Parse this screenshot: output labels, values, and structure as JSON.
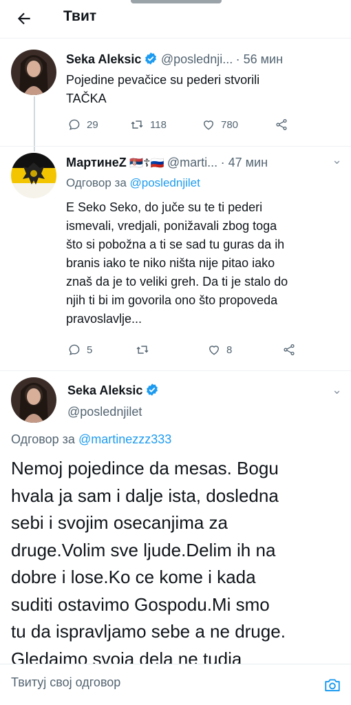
{
  "header": {
    "title": "Твит"
  },
  "tweet1": {
    "name": "Seka Aleksic",
    "handle": "@poslednji...",
    "time": "· 56 мин",
    "text_lines": [
      "Pojedine pevačice su pederi stvorili",
      "TAČKA"
    ],
    "replies": "29",
    "retweets": "118",
    "likes": "780"
  },
  "tweet2": {
    "name": "МартинеZ",
    "flags": "🇷🇸☦🇷🇺",
    "handle": "@marti...",
    "time": "· 47 мин",
    "replying_prefix": "Одговор за",
    "replying_to": "@poslednjilet",
    "text_lines": [
      "E Seko Seko, do juče su te ti pederi",
      "ismevali, vredjali, ponižavali zbog toga",
      "što si pobožna a ti se sad tu guras da ih",
      "branis iako te niko ništa nije pitao iako",
      "znaš da je to veliki greh. Da ti je stalo do",
      "njih ti bi im govorila ono što propoveda",
      "pravoslavlje..."
    ],
    "replies": "5",
    "retweets": "",
    "likes": "8"
  },
  "main_tweet": {
    "name": "Seka Aleksic",
    "handle": "@poslednjilet",
    "replying_prefix": "Одговор за",
    "replying_to": "@martinezzz333",
    "text_lines": [
      "Nemoj pojedince da mesas. Bogu",
      "hvala ja sam i dalje ista, dosledna",
      "sebi i svojim osecanjima za",
      "druge.Volim sve ljude.Delim ih na",
      "dobre i lose.Ko ce kome i kada",
      "suditi ostavimo Gospodu.Mi smo",
      "tu da ispravljamo sebe a ne druge.",
      "Gledajmo svoja dela ne tudja"
    ]
  },
  "reply_bar": {
    "placeholder": "Твитуј свој одговор"
  },
  "colors": {
    "accent": "#1d9bf0",
    "muted": "#536471",
    "text": "#0f1419"
  },
  "icons": [
    "back-arrow-icon",
    "verified-icon",
    "reply-icon",
    "retweet-icon",
    "like-icon",
    "share-icon",
    "more-icon",
    "camera-icon"
  ]
}
